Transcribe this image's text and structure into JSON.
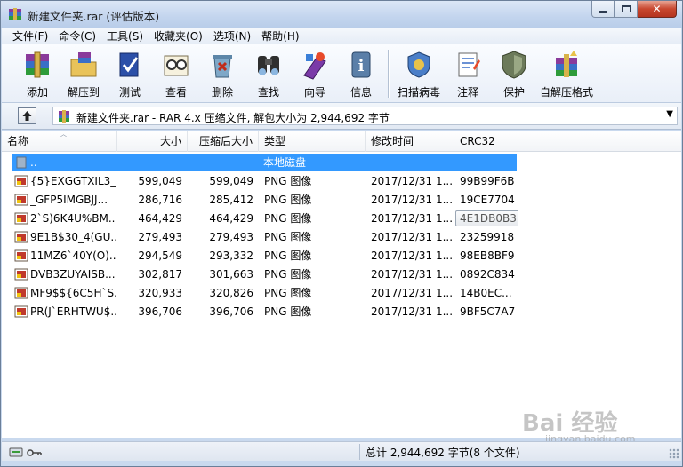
{
  "window": {
    "title": "新建文件夹.rar (评估版本)",
    "controls": {
      "minimize": "minimize",
      "maximize": "maximize",
      "close": "close"
    }
  },
  "menubar": [
    {
      "label": "文件(F)"
    },
    {
      "label": "命令(C)"
    },
    {
      "label": "工具(S)"
    },
    {
      "label": "收藏夹(O)"
    },
    {
      "label": "选项(N)"
    },
    {
      "label": "帮助(H)"
    }
  ],
  "toolbar": [
    {
      "label": "添加",
      "icon": "add-archive-icon"
    },
    {
      "label": "解压到",
      "icon": "extract-to-icon"
    },
    {
      "label": "测试",
      "icon": "test-icon"
    },
    {
      "label": "查看",
      "icon": "view-icon"
    },
    {
      "label": "删除",
      "icon": "delete-icon"
    },
    {
      "label": "查找",
      "icon": "find-icon"
    },
    {
      "label": "向导",
      "icon": "wizard-icon"
    },
    {
      "label": "信息",
      "icon": "info-icon"
    },
    {
      "label": "扫描病毒",
      "icon": "virus-scan-icon"
    },
    {
      "label": "注释",
      "icon": "comment-icon"
    },
    {
      "label": "保护",
      "icon": "protect-icon"
    },
    {
      "label": "自解压格式",
      "icon": "sfx-icon"
    }
  ],
  "address": {
    "path": "新建文件夹.rar - RAR 4.x 压缩文件, 解包大小为 2,944,692 字节"
  },
  "columns": {
    "name": "名称",
    "size": "大小",
    "packed": "压缩后大小",
    "type": "类型",
    "modified": "修改时间",
    "crc": "CRC32"
  },
  "parent_row": {
    "name": "..",
    "type": "本地磁盘"
  },
  "files": [
    {
      "name": "{5}EXGGTXIL3_...",
      "size": "599,049",
      "packed": "599,049",
      "type": "PNG 图像",
      "modified": "2017/12/31 1...",
      "crc": "99B99F6B"
    },
    {
      "name": "_GFP5IMGBJJ...",
      "size": "286,716",
      "packed": "285,412",
      "type": "PNG 图像",
      "modified": "2017/12/31 1...",
      "crc": "19CE7704"
    },
    {
      "name": "2`S)6K4U%BM...",
      "size": "464,429",
      "packed": "464,429",
      "type": "PNG 图像",
      "modified": "2017/12/31 1...",
      "crc": "4E1DB0B3"
    },
    {
      "name": "9E1B$30_4(GU...",
      "size": "279,493",
      "packed": "279,493",
      "type": "PNG 图像",
      "modified": "2017/12/31 1...",
      "crc": "23259918"
    },
    {
      "name": "11MZ6`40Y(O)...",
      "size": "294,549",
      "packed": "293,332",
      "type": "PNG 图像",
      "modified": "2017/12/31 1...",
      "crc": "98EB8BF9"
    },
    {
      "name": "DVB3ZUYAISB...",
      "size": "302,817",
      "packed": "301,663",
      "type": "PNG 图像",
      "modified": "2017/12/31 1...",
      "crc": "0892C834"
    },
    {
      "name": "MF9$${6C5H`S...",
      "size": "320,933",
      "packed": "320,826",
      "type": "PNG 图像",
      "modified": "2017/12/31 1...",
      "crc": "14B0EC..."
    },
    {
      "name": "PR(J`ERHTWU$...",
      "size": "396,706",
      "packed": "396,706",
      "type": "PNG 图像",
      "modified": "2017/12/31 1...",
      "crc": "9BF5C7A7"
    }
  ],
  "status": {
    "summary": "总计 2,944,692 字节(8 个文件)"
  },
  "watermark": {
    "text": "Bai 经验",
    "sub": "jingyan.baidu.com"
  },
  "colors": {
    "selection": "#3399ff",
    "titlebar": "#c3d5ee",
    "close": "#c8472f"
  }
}
